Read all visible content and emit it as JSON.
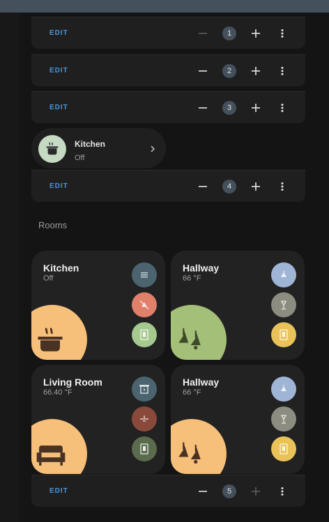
{
  "edit_rows": [
    {
      "edit_label": "EDIT",
      "number": "1"
    },
    {
      "edit_label": "EDIT",
      "number": "2"
    },
    {
      "edit_label": "EDIT",
      "number": "3"
    },
    {
      "edit_label": "EDIT",
      "number": "4"
    },
    {
      "edit_label": "EDIT",
      "number": "5"
    }
  ],
  "chip": {
    "name": "Kitchen",
    "state": "Off",
    "icon": "stove-icon"
  },
  "section_title": "Rooms",
  "rooms": [
    {
      "name": "Kitchen",
      "state": "Off",
      "icon": "stove-icon",
      "accent": "#f6c07a",
      "entities": [
        {
          "icon": "thermostat-icon",
          "color": "#4b6470"
        },
        {
          "icon": "light-off-icon",
          "color": "#e0806b"
        },
        {
          "icon": "switch-icon",
          "color": "#a5c98f"
        }
      ]
    },
    {
      "name": "Hallway",
      "state": "66 °F",
      "icon": "ceiling-lights-icon",
      "accent": "#a4bf78",
      "entities": [
        {
          "icon": "light-icon",
          "color": "#9fb5d6"
        },
        {
          "icon": "lamp-icon",
          "color": "#8d8c80"
        },
        {
          "icon": "switch-icon",
          "color": "#e9c35a"
        }
      ]
    },
    {
      "name": "Living Room",
      "state": "66.40 °F",
      "icon": "sofa-icon",
      "accent": "#f6c07a",
      "entities": [
        {
          "icon": "fireplace-icon",
          "color": "#4b6470"
        },
        {
          "icon": "ceiling-fan-icon",
          "color": "#8a4a3b"
        },
        {
          "icon": "switch-icon",
          "color": "#5b6b4e"
        }
      ]
    },
    {
      "name": "Hallway",
      "state": "66 °F",
      "icon": "ceiling-lights-icon",
      "accent": "#f6c07a",
      "entities": [
        {
          "icon": "light-icon",
          "color": "#9fb5d6"
        },
        {
          "icon": "lamp-icon",
          "color": "#8d8c80"
        },
        {
          "icon": "switch-icon",
          "color": "#e9c35a"
        }
      ]
    }
  ],
  "colors": {
    "edit_blue": "#4d96d9",
    "card_bg": "#222222",
    "page_bg": "#141414"
  }
}
